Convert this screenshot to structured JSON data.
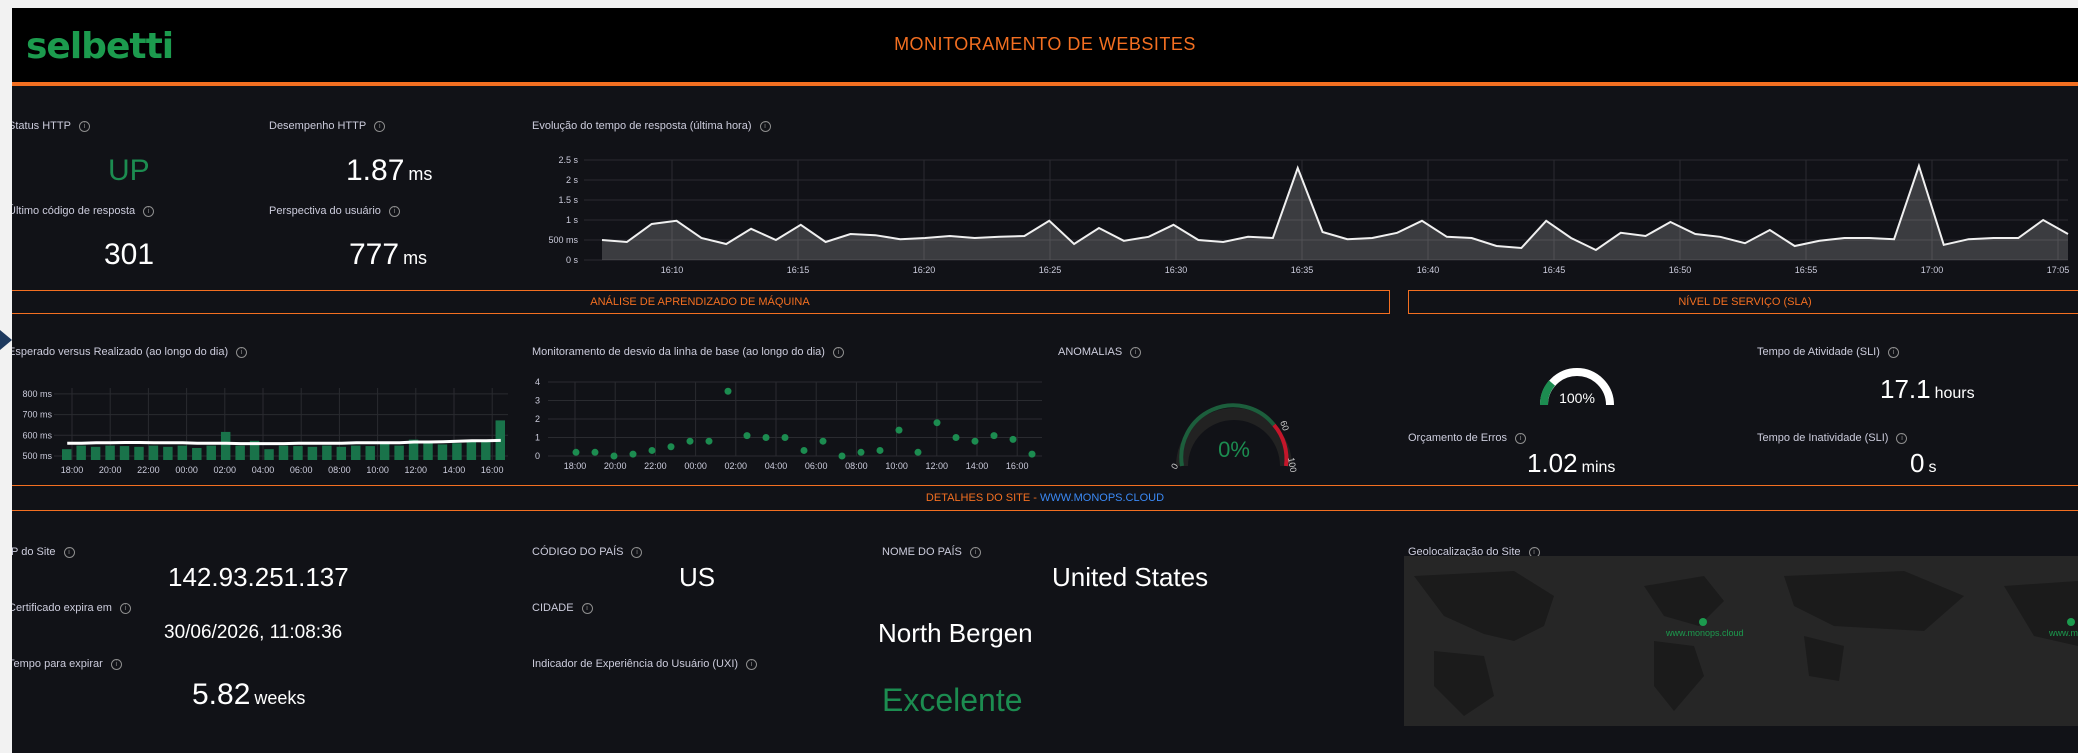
{
  "header": {
    "logo_text": "selbetti",
    "title": "MONITORAMENTO DE WEBSITES"
  },
  "colors": {
    "accent": "#f36f21",
    "good": "#1c8c50",
    "link": "#3b89f5",
    "background": "#111217"
  },
  "status": {
    "http_status_label": "Status HTTP",
    "http_status_value": "UP",
    "http_perf_label": "Desempenho HTTP",
    "http_perf_value": "1.87",
    "http_perf_unit": "ms",
    "last_code_label": "Último código de resposta",
    "last_code_value": "301",
    "user_perspective_label": "Perspectiva do usuário",
    "user_perspective_value": "777",
    "user_perspective_unit": "ms"
  },
  "response_chart": {
    "title": "Evolução do tempo de resposta (última hora)",
    "chart_data": {
      "type": "area",
      "title": "Evolução do tempo de resposta (última hora)",
      "y_ticks": [
        "0 s",
        "500 ms",
        "1 s",
        "1.5 s",
        "2 s",
        "2.5 s"
      ],
      "x_ticks": [
        "16:10",
        "16:15",
        "16:20",
        "16:25",
        "16:30",
        "16:35",
        "16:40",
        "16:45",
        "16:50",
        "16:55",
        "17:00",
        "17:05"
      ],
      "ylim": [
        0,
        2.5
      ],
      "values": [
        0.5,
        0.45,
        0.9,
        0.98,
        0.55,
        0.4,
        0.78,
        0.5,
        0.88,
        0.45,
        0.65,
        0.62,
        0.52,
        0.55,
        0.6,
        0.55,
        0.58,
        0.6,
        0.98,
        0.4,
        0.8,
        0.48,
        0.58,
        0.88,
        0.5,
        0.45,
        0.58,
        0.55,
        2.3,
        0.7,
        0.52,
        0.55,
        0.68,
        0.98,
        0.58,
        0.55,
        0.35,
        0.3,
        0.98,
        0.55,
        0.25,
        0.68,
        0.6,
        0.95,
        0.65,
        0.58,
        0.42,
        0.75,
        0.35,
        0.48,
        0.55,
        0.55,
        0.52,
        2.35,
        0.38,
        0.52,
        0.55,
        0.55,
        1.0,
        0.65
      ]
    }
  },
  "sections": {
    "ml": "ANÁLISE DE APRENDIZADO DE MÁQUINA",
    "sla": "NÍVEL DE SERVIÇO (SLA)",
    "details_prefix": "DETALHES DO SITE - ",
    "details_link": "WWW.MONOPS.CLOUD"
  },
  "expected_chart": {
    "title": "Esperado versus Realizado (ao longo do dia)",
    "chart_data": {
      "type": "bar",
      "y_ticks": [
        "500 ms",
        "600 ms",
        "700 ms",
        "800 ms"
      ],
      "x_ticks": [
        "18:00",
        "20:00",
        "22:00",
        "00:00",
        "02:00",
        "04:00",
        "06:00",
        "08:00",
        "10:00",
        "12:00",
        "14:00",
        "16:00"
      ],
      "ylim": [
        500,
        800
      ],
      "values": [
        545,
        560,
        555,
        560,
        558,
        555,
        560,
        555,
        560,
        550,
        560,
        617,
        560,
        580,
        545,
        560,
        558,
        555,
        560,
        555,
        560,
        558,
        575,
        560,
        585,
        575,
        565,
        570,
        580,
        575,
        665
      ],
      "expected": [
        570,
        570,
        572,
        572,
        573,
        573,
        572,
        572,
        572,
        570,
        570,
        570,
        568,
        568,
        568,
        568,
        570,
        570,
        570,
        570,
        572,
        572,
        572,
        572,
        575,
        575,
        576,
        578,
        580,
        580,
        582
      ]
    }
  },
  "baseline_chart": {
    "title": "Monitoramento de desvio da linha de base (ao longo do dia)",
    "chart_data": {
      "type": "scatter",
      "y_ticks": [
        "0",
        "1",
        "2",
        "3",
        "4"
      ],
      "x_ticks": [
        "18:00",
        "20:00",
        "22:00",
        "00:00",
        "02:00",
        "04:00",
        "06:00",
        "08:00",
        "10:00",
        "12:00",
        "14:00",
        "16:00"
      ],
      "ylim": [
        0,
        4
      ],
      "x": [
        0,
        1,
        2,
        3,
        4,
        5,
        6,
        7,
        8,
        9,
        10,
        11,
        12,
        13,
        14,
        15,
        16,
        17,
        18,
        19,
        20,
        21,
        22,
        23,
        24
      ],
      "values": [
        0.2,
        0.2,
        0.0,
        0.1,
        0.3,
        0.5,
        0.8,
        0.8,
        3.5,
        1.1,
        1.0,
        1.0,
        0.3,
        0.8,
        0.0,
        0.2,
        0.3,
        1.4,
        0.2,
        1.8,
        1.0,
        0.8,
        1.1,
        0.9,
        0.1
      ]
    }
  },
  "anomalies": {
    "title": "ANOMALIAS",
    "value": "0%",
    "gauge_min": "0",
    "gauge_mid": "60",
    "gauge_max": "100"
  },
  "sla": {
    "availability_value": "100%",
    "uptime_label": "Tempo de Atividade (SLI)",
    "uptime_value": "17.1",
    "uptime_unit": "hours",
    "error_budget_label": "Orçamento de Erros",
    "error_budget_value": "1.02",
    "error_budget_unit": "mins",
    "downtime_label": "Tempo de Inatividade (SLI)",
    "downtime_value": "0",
    "downtime_unit": "s"
  },
  "details": {
    "ip_label": "IP do Site",
    "ip_value": "142.93.251.137",
    "cert_label": "Certificado expira em",
    "cert_value": "30/06/2026, 11:08:36",
    "expire_label": "Tempo para expirar",
    "expire_value": "5.82",
    "expire_unit": "weeks",
    "country_code_label": "CÓDIGO DO PAÍS",
    "country_code_value": "US",
    "country_name_label": "NOME DO PAÍS",
    "country_name_value": "United States",
    "city_label": "CIDADE",
    "city_value": "North Bergen",
    "uxi_label": "Indicador de Experiência do Usuário (UXI)",
    "uxi_value": "Excelente",
    "geo_label": "Geolocalização do Site",
    "geo_pin_label": "www.monops.cloud"
  }
}
